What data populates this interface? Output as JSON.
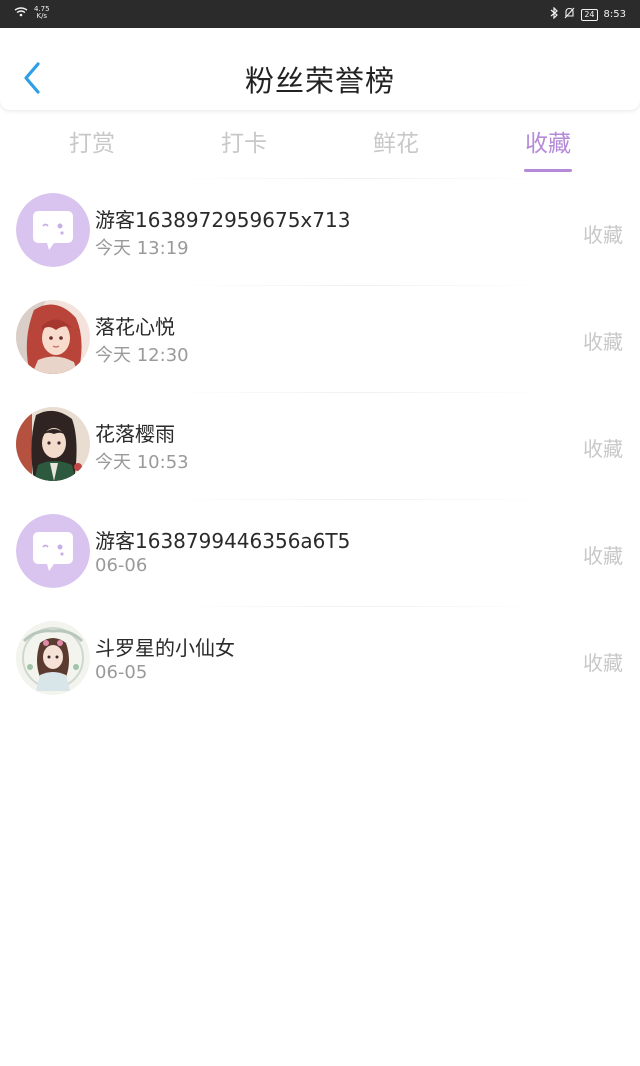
{
  "status_bar": {
    "net_speed": "4.75",
    "net_unit": "K/s",
    "battery": "24",
    "time": "8:53"
  },
  "header": {
    "title": "粉丝荣誉榜"
  },
  "tabs": [
    {
      "label": "打赏",
      "active": false
    },
    {
      "label": "打卡",
      "active": false
    },
    {
      "label": "鲜花",
      "active": false
    },
    {
      "label": "收藏",
      "active": true
    }
  ],
  "colors": {
    "accent": "#b58ad8",
    "back_icon": "#2e9fe6"
  },
  "fans": [
    {
      "name": "游客1638972959675x713",
      "time": "今天 13:19",
      "action": "收藏",
      "avatar": "chat-bubble-icon"
    },
    {
      "name": "落花心悦",
      "time": "今天 12:30",
      "action": "收藏",
      "avatar": "user-avatar"
    },
    {
      "name": "花落樱雨",
      "time": "今天 10:53",
      "action": "收藏",
      "avatar": "user-avatar"
    },
    {
      "name": "游客1638799446356a6T5",
      "time": "06-06",
      "action": "收藏",
      "avatar": "chat-bubble-icon"
    },
    {
      "name": "斗罗星的小仙女",
      "time": "06-05",
      "action": "收藏",
      "avatar": "user-avatar"
    }
  ]
}
